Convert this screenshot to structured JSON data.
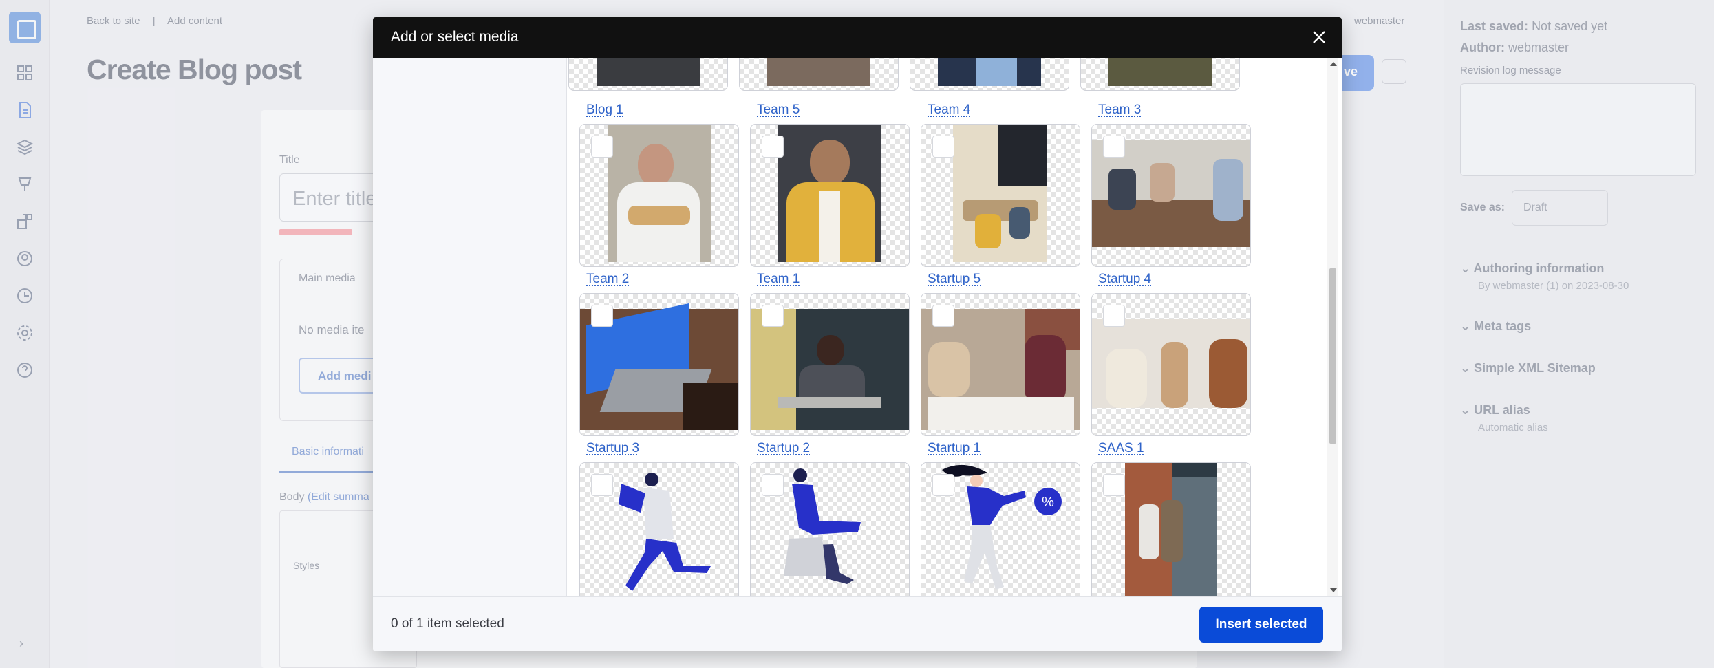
{
  "background": {
    "topbar": {
      "back_label": "Back to site",
      "separator": "|",
      "crumb": "Add content",
      "user": "webmaster"
    },
    "page_title": "Create Blog post",
    "save_button": "ve",
    "form": {
      "title_label": "Title",
      "title_placeholder": "Enter title",
      "main_media_label": "Main media",
      "no_media_text": "No media ite",
      "add_media_label": "Add medi",
      "tab_basic": "Basic informati",
      "body_label": "Body",
      "edit_summary": "(Edit summa",
      "styles_label": "Styles"
    },
    "right_panel": {
      "last_saved_label": "Last saved:",
      "last_saved_value": "Not saved yet",
      "author_label": "Author:",
      "author_value": "webmaster",
      "revision_label": "Revision log message",
      "save_as_label": "Save as:",
      "save_as_value": "Draft",
      "authoring_title": "Authoring information",
      "authoring_sub": "By webmaster (1) on 2023-08-30",
      "meta_tags": "Meta tags",
      "sitemap": "Simple XML Sitemap",
      "url_alias": "URL alias",
      "url_alias_sub": "Automatic alias"
    }
  },
  "modal": {
    "title": "Add or select media",
    "labels_top_row": [
      "Blog 1",
      "Team 5",
      "Team 4",
      "Team 3"
    ],
    "rows": [
      {
        "thumb_names": [
          "Team 5",
          "Team 4",
          "Team 3",
          "Team 2"
        ],
        "labels": [
          "Team 2",
          "Team 1",
          "Startup 5",
          "Startup 4"
        ]
      },
      {
        "labels": [
          "Startup 3",
          "Startup 2",
          "Startup 1",
          "SAAS 1"
        ]
      }
    ],
    "selection_status": "0 of 1 item selected",
    "insert_button": "Insert selected",
    "icons": {
      "close": "close-icon",
      "scroll_up": "arrow-up-icon",
      "scroll_down": "arrow-down-icon"
    }
  }
}
